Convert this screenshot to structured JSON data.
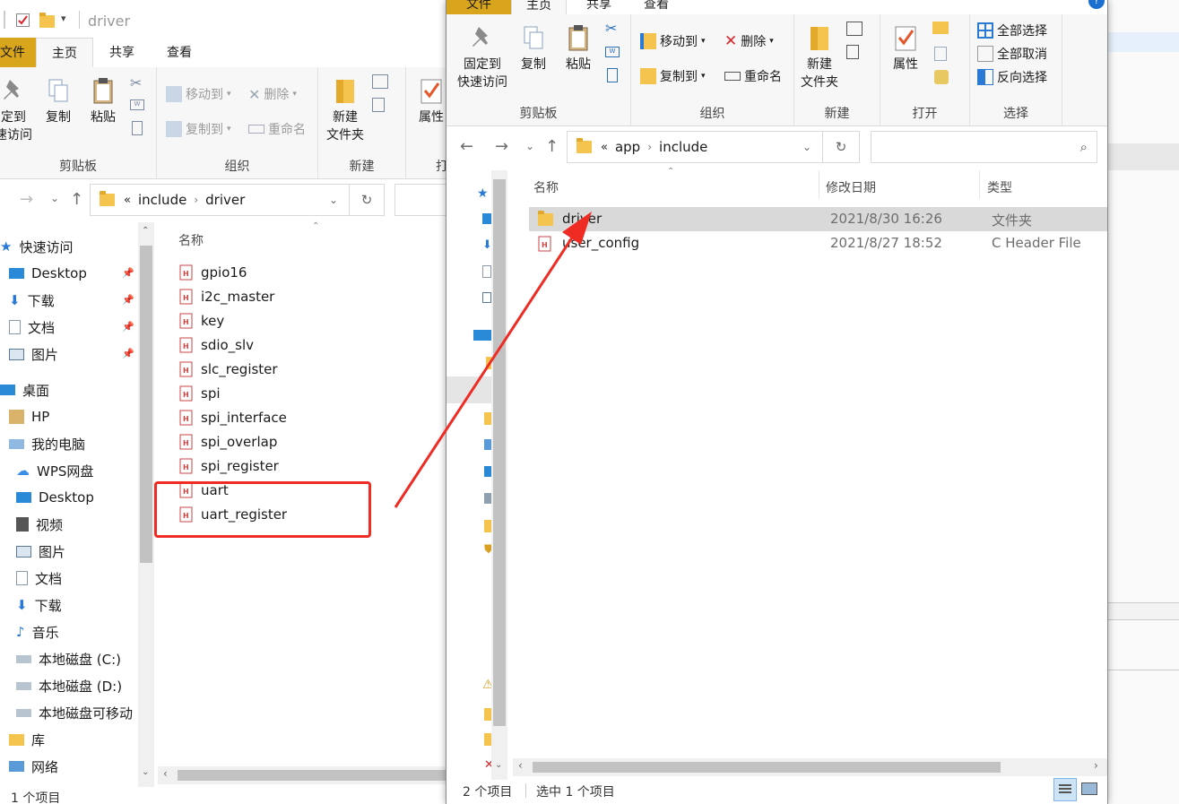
{
  "back_window": {
    "title": "driver",
    "tabs": [
      {
        "label": "文件"
      },
      {
        "label": "主页"
      },
      {
        "label": "共享"
      },
      {
        "label": "查看"
      }
    ],
    "ribbon": {
      "pin_label_1": "定到",
      "pin_label_2": "速访问",
      "copy": "复制",
      "paste": "粘贴",
      "move_to": "移动到",
      "copy_to": "复制到",
      "delete": "删除",
      "rename": "重命名",
      "new_folder_1": "新建",
      "new_folder_2": "文件夹",
      "properties": "属性",
      "open_partial": "打",
      "group_clipboard": "剪贴板",
      "group_organize": "组织",
      "group_new": "新建"
    },
    "address": {
      "chevron": "«",
      "parts": [
        "include",
        "driver"
      ]
    },
    "column_name": "名称",
    "files": [
      "gpio16",
      "i2c_master",
      "key",
      "sdio_slv",
      "slc_register",
      "spi",
      "spi_interface",
      "spi_overlap",
      "spi_register",
      "uart",
      "uart_register"
    ],
    "nav": [
      {
        "label": "快速访问",
        "icon": "star-icon"
      },
      {
        "label": "Desktop",
        "icon": "desktop-icon"
      },
      {
        "label": "下载",
        "icon": "download-icon"
      },
      {
        "label": "文档",
        "icon": "document-icon"
      },
      {
        "label": "图片",
        "icon": "picture-icon"
      },
      {
        "label": "桌面",
        "icon": "desktop-icon"
      },
      {
        "label": "HP",
        "icon": "user-icon"
      },
      {
        "label": "我的电脑",
        "icon": "computer-icon"
      },
      {
        "label": "WPS网盘",
        "icon": "cloud-icon"
      },
      {
        "label": "Desktop",
        "icon": "desktop-icon"
      },
      {
        "label": "视频",
        "icon": "video-icon"
      },
      {
        "label": "图片",
        "icon": "picture-icon"
      },
      {
        "label": "文档",
        "icon": "document-icon"
      },
      {
        "label": "下载",
        "icon": "download-icon"
      },
      {
        "label": "音乐",
        "icon": "music-icon"
      },
      {
        "label": "本地磁盘 (C:)",
        "icon": "drive-c-icon"
      },
      {
        "label": "本地磁盘 (D:)",
        "icon": "drive-icon"
      },
      {
        "label": "本地磁盘可移动",
        "icon": "drive-icon"
      },
      {
        "label": "库",
        "icon": "library-icon"
      },
      {
        "label": "网络",
        "icon": "network-icon"
      }
    ],
    "status": "1 个项目"
  },
  "front_window": {
    "tabs": [
      {
        "label": "文件"
      },
      {
        "label": "主页"
      },
      {
        "label": "共享"
      },
      {
        "label": "查看"
      }
    ],
    "ribbon": {
      "pin_1": "固定到",
      "pin_2": "快速访问",
      "copy": "复制",
      "paste": "粘贴",
      "move_to": "移动到",
      "copy_to": "复制到",
      "delete": "删除",
      "rename": "重命名",
      "new_folder_1": "新建",
      "new_folder_2": "文件夹",
      "properties": "属性",
      "select_all": "全部选择",
      "select_none": "全部取消",
      "invert_select": "反向选择",
      "group_clipboard": "剪贴板",
      "group_organize": "组织",
      "group_new": "新建",
      "group_open": "打开",
      "group_select": "选择"
    },
    "address": {
      "chevron": "«",
      "parts": [
        "app",
        "include"
      ]
    },
    "columns": {
      "name": "名称",
      "date": "修改日期",
      "type": "类型"
    },
    "files": [
      {
        "name": "driver",
        "date": "2021/8/30 16:26",
        "type": "文件夹",
        "kind": "folder",
        "selected": true
      },
      {
        "name": "user_config",
        "date": "2021/8/27 18:52",
        "type": "C Header File",
        "kind": "header",
        "selected": false
      }
    ],
    "status": {
      "count": "2 个项目",
      "selected": "选中 1 个项目"
    }
  },
  "colors": {
    "annotation_red": "#ee2c24",
    "file_tab": "#e8b923",
    "selection": "#d9d9d9"
  }
}
